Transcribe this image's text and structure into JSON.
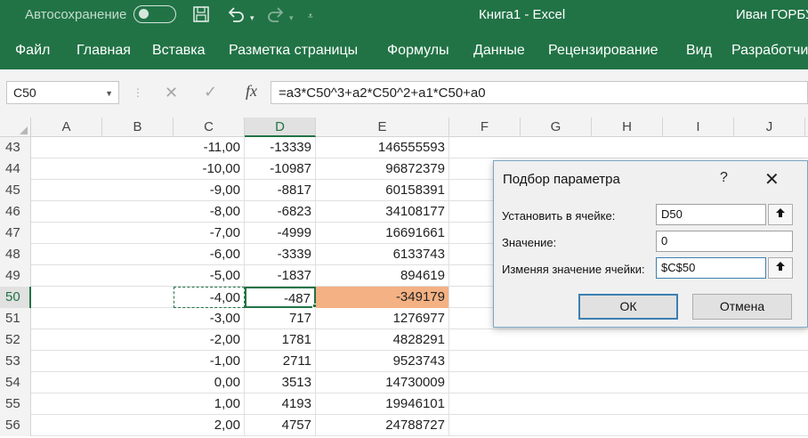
{
  "titlebar": {
    "autosave_label": "Автосохранение",
    "doc_title": "Книга1  -  Excel",
    "user_name": "Иван ГОРБУ"
  },
  "ribbon": {
    "tabs": [
      "Файл",
      "Главная",
      "Вставка",
      "Разметка страницы",
      "Формулы",
      "Данные",
      "Рецензирование",
      "Вид",
      "Разработчи"
    ]
  },
  "formula_bar": {
    "name_box": "C50",
    "formula": "=a3*C50^3+a2*C50^2+a1*C50+a0"
  },
  "grid": {
    "columns": [
      "A",
      "B",
      "C",
      "D",
      "E",
      "F",
      "G",
      "H",
      "I",
      "J"
    ],
    "rows": [
      {
        "num": "43",
        "c": "-11,00",
        "d": "-13339",
        "e": "146555593"
      },
      {
        "num": "44",
        "c": "-10,00",
        "d": "-10987",
        "e": "96872379"
      },
      {
        "num": "45",
        "c": "-9,00",
        "d": "-8817",
        "e": "60158391"
      },
      {
        "num": "46",
        "c": "-8,00",
        "d": "-6823",
        "e": "34108177"
      },
      {
        "num": "47",
        "c": "-7,00",
        "d": "-4999",
        "e": "16691661"
      },
      {
        "num": "48",
        "c": "-6,00",
        "d": "-3339",
        "e": "6133743"
      },
      {
        "num": "49",
        "c": "-5,00",
        "d": "-1837",
        "e": "894619"
      },
      {
        "num": "50",
        "c": "-4,00",
        "d": "-487",
        "e": "-349179"
      },
      {
        "num": "51",
        "c": "-3,00",
        "d": "717",
        "e": "1276977"
      },
      {
        "num": "52",
        "c": "-2,00",
        "d": "1781",
        "e": "4828291"
      },
      {
        "num": "53",
        "c": "-1,00",
        "d": "2711",
        "e": "9523743"
      },
      {
        "num": "54",
        "c": "0,00",
        "d": "3513",
        "e": "14730009"
      },
      {
        "num": "55",
        "c": "1,00",
        "d": "4193",
        "e": "19946101"
      },
      {
        "num": "56",
        "c": "2,00",
        "d": "4757",
        "e": "24788727"
      }
    ],
    "highlight_color": "#f4b183",
    "accent_color": "#217346"
  },
  "dialog": {
    "title": "Подбор параметра",
    "help": "?",
    "close": "✕",
    "set_cell_label": "Установить в ячейке:",
    "set_cell_value": "D50",
    "value_label": "Значение:",
    "value_value": "0",
    "changing_label": "Изменяя значение ячейки:",
    "changing_value": "$C$50",
    "ok_label": "ОК",
    "cancel_label": "Отмена"
  }
}
